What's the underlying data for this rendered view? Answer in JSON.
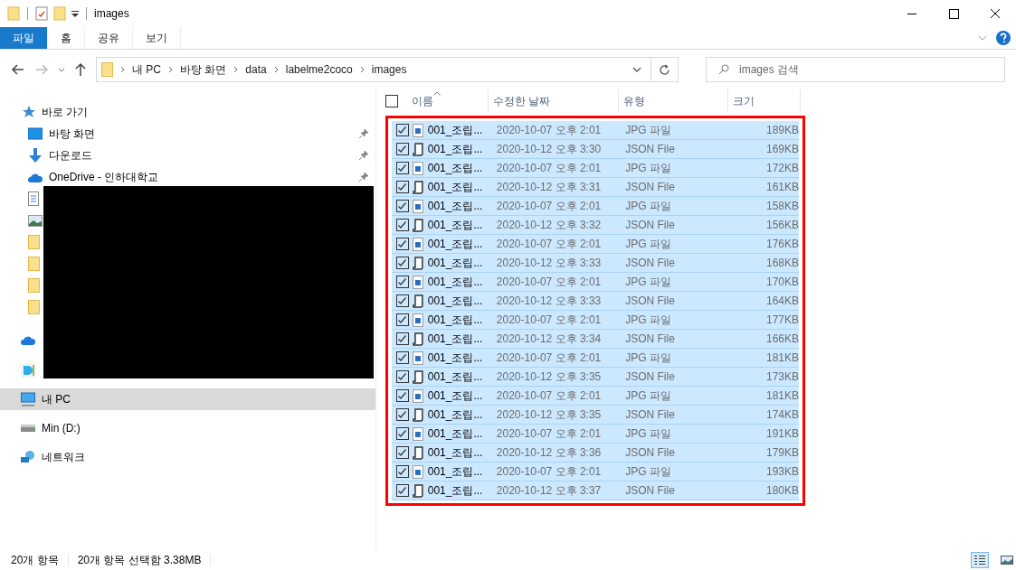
{
  "window": {
    "title": "images"
  },
  "ribbon_tabs": [
    {
      "label": "파일",
      "selected": true
    },
    {
      "label": "홈",
      "selected": false
    },
    {
      "label": "공유",
      "selected": false
    },
    {
      "label": "보기",
      "selected": false
    }
  ],
  "address": {
    "crumbs": [
      "내 PC",
      "바탕 화면",
      "data",
      "labelme2coco",
      "images"
    ]
  },
  "search": {
    "placeholder": "images 검색"
  },
  "sidebar": {
    "redacted": true,
    "items": [
      {
        "kind": "star",
        "label": "바로 가기",
        "pinned": false,
        "selected": false,
        "children": [
          {
            "kind": "desktop",
            "label": "바탕 화면",
            "pinned": true,
            "selected": false
          },
          {
            "kind": "download",
            "label": "다운로드",
            "pinned": true,
            "selected": false
          },
          {
            "kind": "cloud",
            "label": "OneDrive - 인하대학교",
            "pinned": true,
            "selected": false
          },
          {
            "kind": "document",
            "pinned": false,
            "selected": false
          },
          {
            "kind": "image",
            "pinned": false,
            "selected": false
          },
          {
            "kind": "folder",
            "pinned": false,
            "selected": false
          },
          {
            "kind": "folder",
            "pinned": false,
            "selected": false
          },
          {
            "kind": "folder",
            "pinned": false,
            "selected": false
          },
          {
            "kind": "folder",
            "pinned": false,
            "selected": false
          }
        ]
      },
      {
        "kind": "cloud",
        "pinned": false,
        "selected": false
      },
      {
        "kind": "app",
        "pinned": false,
        "selected": false
      },
      {
        "kind": "pc",
        "label": "내 PC",
        "pinned": false,
        "selected": true
      },
      {
        "kind": "drive",
        "label": "Min (D:)",
        "pinned": false,
        "selected": false
      },
      {
        "kind": "network",
        "label": "네트워크",
        "pinned": false,
        "selected": false
      }
    ]
  },
  "table": {
    "select_all_checked": false,
    "columns": [
      "이름",
      "수정한 날짜",
      "유형",
      "크기"
    ],
    "rows": [
      {
        "kind": "jpg",
        "name": "001_조립...",
        "date": "2020-10-07 오후 2:01",
        "type": "JPG 파일",
        "size": "189KB",
        "selected": true
      },
      {
        "kind": "json",
        "name": "001_조립...",
        "date": "2020-10-12 오후 3:30",
        "type": "JSON File",
        "size": "169KB",
        "selected": true
      },
      {
        "kind": "jpg",
        "name": "001_조립...",
        "date": "2020-10-07 오후 2:01",
        "type": "JPG 파일",
        "size": "172KB",
        "selected": true
      },
      {
        "kind": "json",
        "name": "001_조립...",
        "date": "2020-10-12 오후 3:31",
        "type": "JSON File",
        "size": "161KB",
        "selected": true
      },
      {
        "kind": "jpg",
        "name": "001_조립...",
        "date": "2020-10-07 오후 2:01",
        "type": "JPG 파일",
        "size": "158KB",
        "selected": true
      },
      {
        "kind": "json",
        "name": "001_조립...",
        "date": "2020-10-12 오후 3:32",
        "type": "JSON File",
        "size": "156KB",
        "selected": true
      },
      {
        "kind": "jpg",
        "name": "001_조립...",
        "date": "2020-10-07 오후 2:01",
        "type": "JPG 파일",
        "size": "176KB",
        "selected": true
      },
      {
        "kind": "json",
        "name": "001_조립...",
        "date": "2020-10-12 오후 3:33",
        "type": "JSON File",
        "size": "168KB",
        "selected": true
      },
      {
        "kind": "jpg",
        "name": "001_조립...",
        "date": "2020-10-07 오후 2:01",
        "type": "JPG 파일",
        "size": "170KB",
        "selected": true
      },
      {
        "kind": "json",
        "name": "001_조립...",
        "date": "2020-10-12 오후 3:33",
        "type": "JSON File",
        "size": "164KB",
        "selected": true
      },
      {
        "kind": "jpg",
        "name": "001_조립...",
        "date": "2020-10-07 오후 2:01",
        "type": "JPG 파일",
        "size": "177KB",
        "selected": true
      },
      {
        "kind": "json",
        "name": "001_조립...",
        "date": "2020-10-12 오후 3:34",
        "type": "JSON File",
        "size": "166KB",
        "selected": true
      },
      {
        "kind": "jpg",
        "name": "001_조립...",
        "date": "2020-10-07 오후 2:01",
        "type": "JPG 파일",
        "size": "181KB",
        "selected": true
      },
      {
        "kind": "json",
        "name": "001_조립...",
        "date": "2020-10-12 오후 3:35",
        "type": "JSON File",
        "size": "173KB",
        "selected": true
      },
      {
        "kind": "jpg",
        "name": "001_조립...",
        "date": "2020-10-07 오후 2:01",
        "type": "JPG 파일",
        "size": "181KB",
        "selected": true
      },
      {
        "kind": "json",
        "name": "001_조립...",
        "date": "2020-10-12 오후 3:35",
        "type": "JSON File",
        "size": "174KB",
        "selected": true
      },
      {
        "kind": "jpg",
        "name": "001_조립...",
        "date": "2020-10-07 오후 2:01",
        "type": "JPG 파일",
        "size": "191KB",
        "selected": true
      },
      {
        "kind": "json",
        "name": "001_조립...",
        "date": "2020-10-12 오후 3:36",
        "type": "JSON File",
        "size": "179KB",
        "selected": true
      },
      {
        "kind": "jpg",
        "name": "001_조립...",
        "date": "2020-10-07 오후 2:01",
        "type": "JPG 파일",
        "size": "193KB",
        "selected": true
      },
      {
        "kind": "json",
        "name": "001_조립...",
        "date": "2020-10-12 오후 3:37",
        "type": "JSON File",
        "size": "180KB",
        "selected": true
      }
    ]
  },
  "status_bar": {
    "item_count": "20개 항목",
    "selection": "20개 항목 선택함 3.38MB",
    "views": [
      {
        "kind": "details",
        "selected": true
      },
      {
        "kind": "thumbnails",
        "selected": false
      }
    ]
  }
}
